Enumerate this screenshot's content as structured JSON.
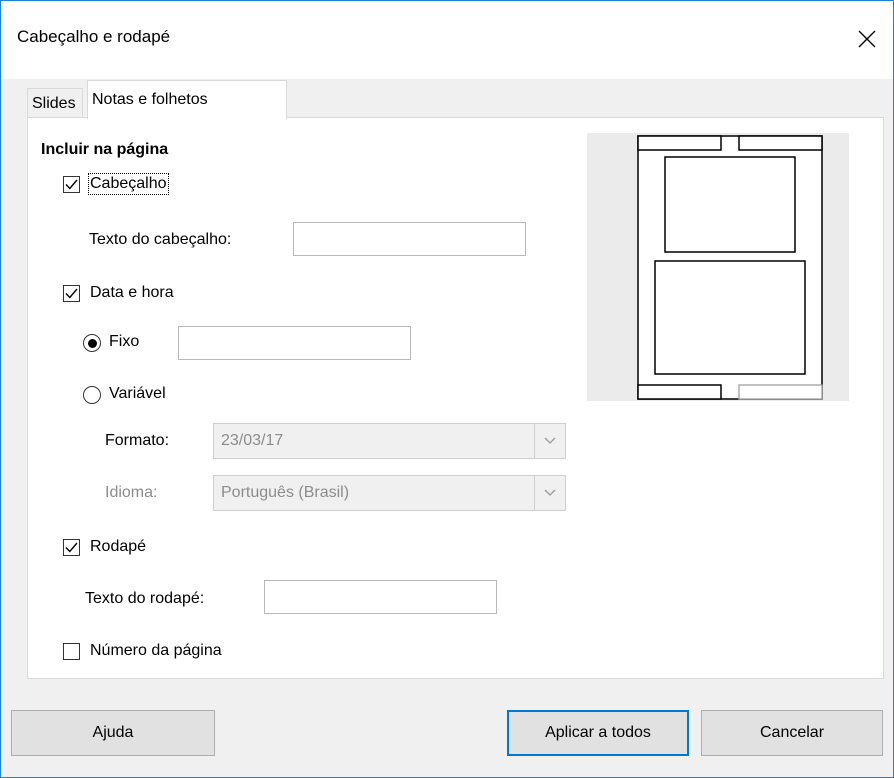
{
  "dialog": {
    "title": "Cabeçalho e rodapé"
  },
  "tabs": [
    {
      "label": "Slides",
      "active": false
    },
    {
      "label": "Notas e folhetos",
      "active": true
    }
  ],
  "section": {
    "title": "Incluir na página"
  },
  "header": {
    "checkbox_label": "Cabeçalho",
    "checked": true,
    "text_label": "Texto do cabeçalho:",
    "text_value": ""
  },
  "datetime": {
    "checkbox_label": "Data e hora",
    "checked": true,
    "fixed_label": "Fixo",
    "fixed_selected": true,
    "fixed_value": "",
    "variable_label": "Variável",
    "format_label": "Formato:",
    "format_value": "23/03/17",
    "language_label": "Idioma:",
    "language_value": "Português (Brasil)"
  },
  "footer": {
    "checkbox_label": "Rodapé",
    "checked": true,
    "text_label": "Texto do rodapé:",
    "text_value": ""
  },
  "page_number": {
    "checkbox_label": "Número da página",
    "checked": false
  },
  "buttons": {
    "help": "Ajuda",
    "apply_all": "Aplicar a todos",
    "cancel": "Cancelar"
  },
  "colors": {
    "accent": "#0078d7",
    "window_border": "#1883d7",
    "disabled_text": "#8c8c8c"
  }
}
